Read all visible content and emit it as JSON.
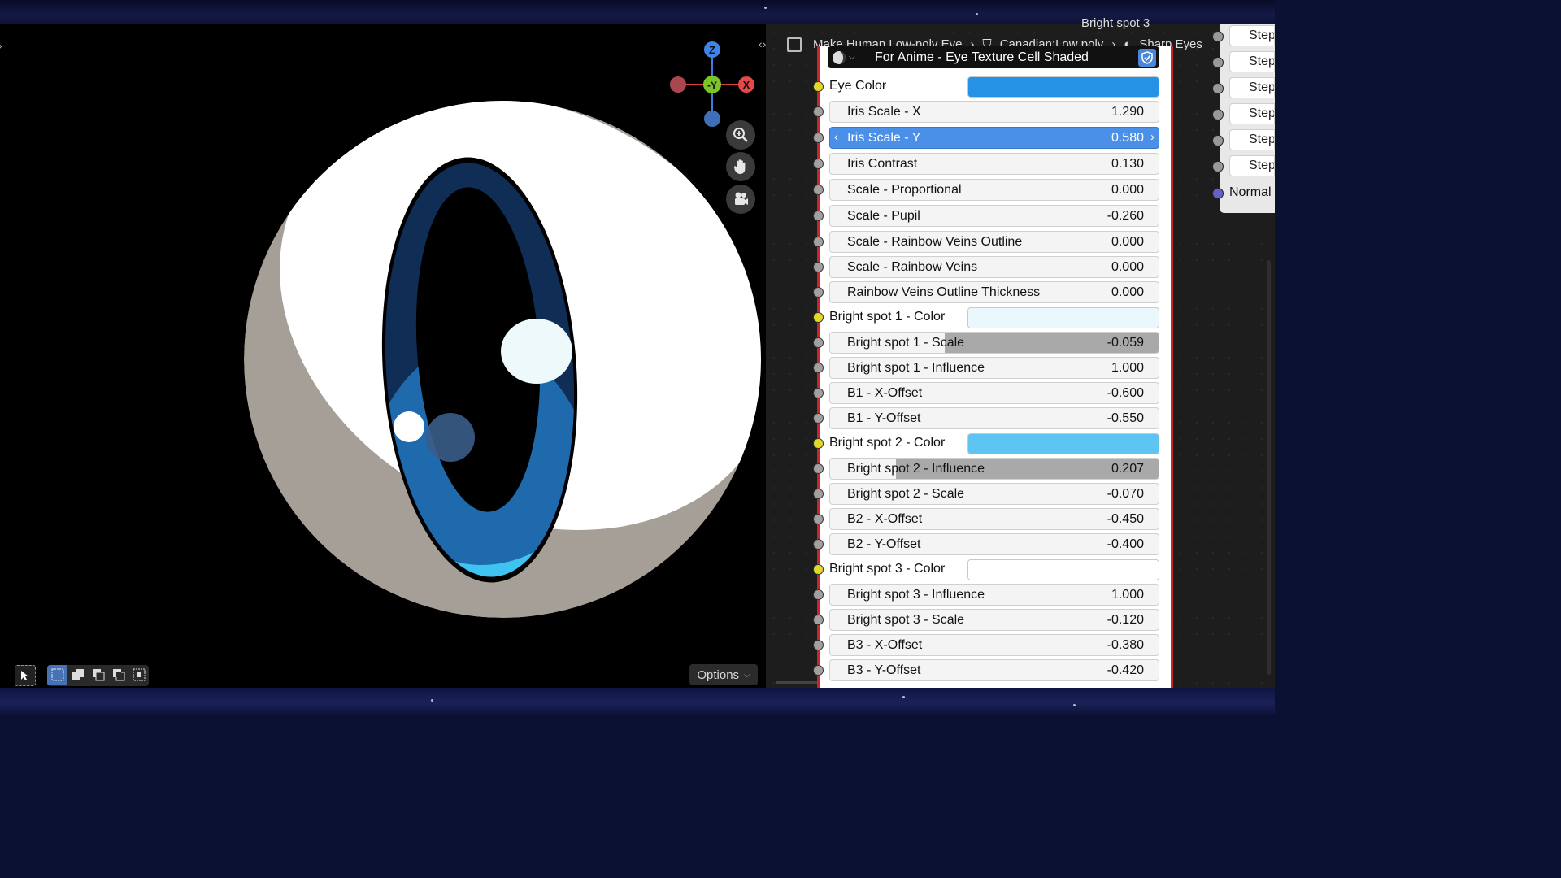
{
  "viewport": {
    "gizmo": {
      "z": "Z",
      "y": "-Y",
      "x": "X"
    },
    "options_label": "Options",
    "icons": {
      "zoom": "zoom-in-icon",
      "pan": "hand-icon",
      "camera": "camera-icon",
      "cursor": "cursor-icon"
    },
    "eye_colors": {
      "sclera": "#ffffff",
      "shadow": "#a29c95",
      "iris_dark": "#0f2d55",
      "iris_mid": "#1f6aac",
      "iris_light": "#3fc3f0",
      "pupil": "#000000"
    }
  },
  "node_editor": {
    "breadcrumb": [
      "Make Human Low-poly Eye",
      "Canadian:Low poly",
      "Sharp Eyes"
    ],
    "top_cut_label": "Bright spot 3",
    "right_panel": {
      "rows": [
        "Step",
        "Step",
        "Step",
        "Step",
        "Step",
        "Step"
      ],
      "normal_label": "Normal"
    }
  },
  "node": {
    "title": "For Anime - Eye Texture Cell Shaded",
    "accent": "#4a90e8",
    "rows": [
      {
        "type": "color",
        "label": "Eye Color",
        "color": "#2592e6"
      },
      {
        "type": "value",
        "label": "Iris Scale - X",
        "value": "1.290"
      },
      {
        "type": "value",
        "label": "Iris Scale - Y",
        "value": "0.580",
        "active": true
      },
      {
        "type": "value",
        "label": "Iris Contrast",
        "value": "0.130"
      },
      {
        "type": "value",
        "label": "Scale - Proportional",
        "value": "0.000"
      },
      {
        "type": "value",
        "label": "Scale - Pupil",
        "value": "-0.260"
      },
      {
        "type": "value",
        "label": "Scale - Rainbow Veins Outline",
        "value": "0.000"
      },
      {
        "type": "value",
        "label": "Scale - Rainbow Veins",
        "value": "0.000"
      },
      {
        "type": "value",
        "label": "Rainbow Veins Outline Thickness",
        "value": "0.000"
      },
      {
        "type": "color",
        "label": "Bright spot 1 - Color",
        "color": "#eaf8fd"
      },
      {
        "type": "value",
        "label": "Bright spot 1 - Scale",
        "value": "-0.059",
        "fill": 0.65
      },
      {
        "type": "value",
        "label": "Bright spot 1 - Influence",
        "value": "1.000"
      },
      {
        "type": "value",
        "label": "B1 - X-Offset",
        "value": "-0.600"
      },
      {
        "type": "value",
        "label": "B1 - Y-Offset",
        "value": "-0.550"
      },
      {
        "type": "color",
        "label": "Bright spot 2 - Color",
        "color": "#5ec5f2"
      },
      {
        "type": "value",
        "label": "Bright spot 2 - Influence",
        "value": "0.207",
        "fill": 0.8
      },
      {
        "type": "value",
        "label": "Bright spot 2 - Scale",
        "value": "-0.070"
      },
      {
        "type": "value",
        "label": "B2 - X-Offset",
        "value": "-0.450"
      },
      {
        "type": "value",
        "label": "B2 - Y-Offset",
        "value": "-0.400"
      },
      {
        "type": "color",
        "label": "Bright spot 3 - Color",
        "color": "#ffffff"
      },
      {
        "type": "value",
        "label": "Bright spot 3 - Influence",
        "value": "1.000"
      },
      {
        "type": "value",
        "label": "Bright spot 3 - Scale",
        "value": "-0.120"
      },
      {
        "type": "value",
        "label": "B3 - X-Offset",
        "value": "-0.380"
      },
      {
        "type": "value",
        "label": "B3 - Y-Offset",
        "value": "-0.420"
      }
    ]
  }
}
